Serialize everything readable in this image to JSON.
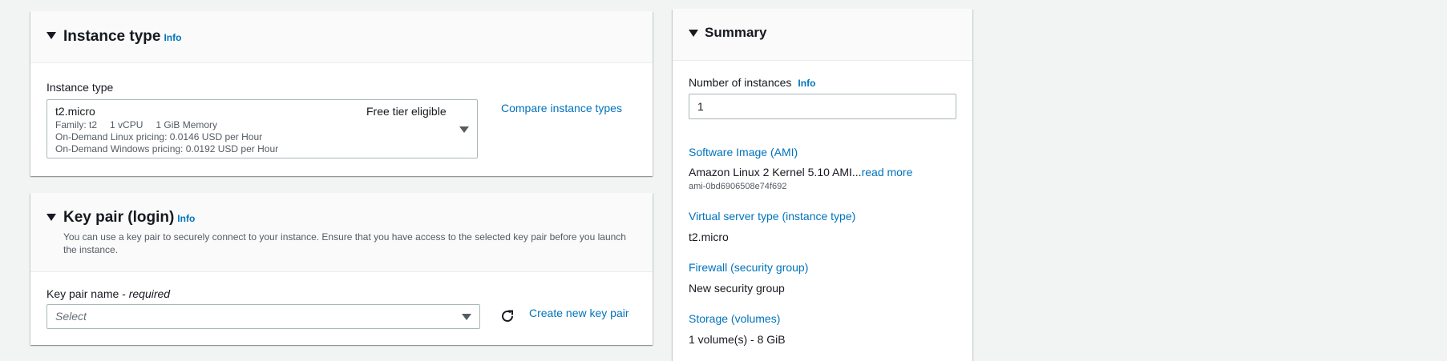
{
  "instance_type_panel": {
    "title": "Instance type",
    "info": "Info",
    "field_label": "Instance type",
    "selected": {
      "name": "t2.micro",
      "free_tier": "Free tier eligible",
      "family": "Family: t2",
      "vcpu": "1 vCPU",
      "memory": "1 GiB Memory",
      "linux_pricing": "On-Demand Linux pricing: 0.0146 USD per Hour",
      "windows_pricing": "On-Demand Windows pricing: 0.0192 USD per Hour"
    },
    "compare_link": "Compare instance types"
  },
  "key_pair_panel": {
    "title": "Key pair (login)",
    "info": "Info",
    "description_line1": "You can use a key pair to securely connect to your instance. Ensure that you have access to the selected key pair before you launch",
    "description_line2": "the instance.",
    "field_label": "Key pair name - ",
    "field_required": "required",
    "select_placeholder": "Select",
    "create_link": "Create new key pair"
  },
  "summary_panel": {
    "title": "Summary",
    "num_instances_label": "Number of instances",
    "info": "Info",
    "num_instances_value": "1",
    "ami_label": "Software Image (AMI)",
    "ami_value": "Amazon Linux 2 Kernel 5.10 AMI...",
    "ami_read_more": "read more",
    "ami_id": "ami-0bd6906508e74f692",
    "server_type_label": "Virtual server type (instance type)",
    "server_type_value": "t2.micro",
    "firewall_label": "Firewall (security group)",
    "firewall_value": "New security group",
    "storage_label": "Storage (volumes)",
    "storage_value": "1 volume(s) - 8 GiB"
  }
}
